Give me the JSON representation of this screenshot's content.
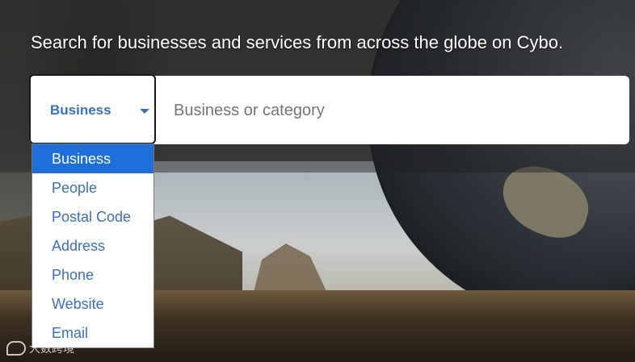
{
  "headline": "Search for businesses and services from across the globe on Cybo.",
  "search": {
    "category_selected": "Business",
    "placeholder": "Business or category",
    "value": ""
  },
  "dropdown": {
    "options": [
      "Business",
      "People",
      "Postal Code",
      "Address",
      "Phone",
      "Website",
      "Email"
    ],
    "selected_index": 0
  },
  "watermark": {
    "text": "大数跨境"
  },
  "colors": {
    "accent": "#3b6fbf",
    "selected_bg": "#1e6fd9"
  },
  "icons": {
    "caret": "chevron-down-icon",
    "watermark_logo": "watermark-logo-icon"
  }
}
